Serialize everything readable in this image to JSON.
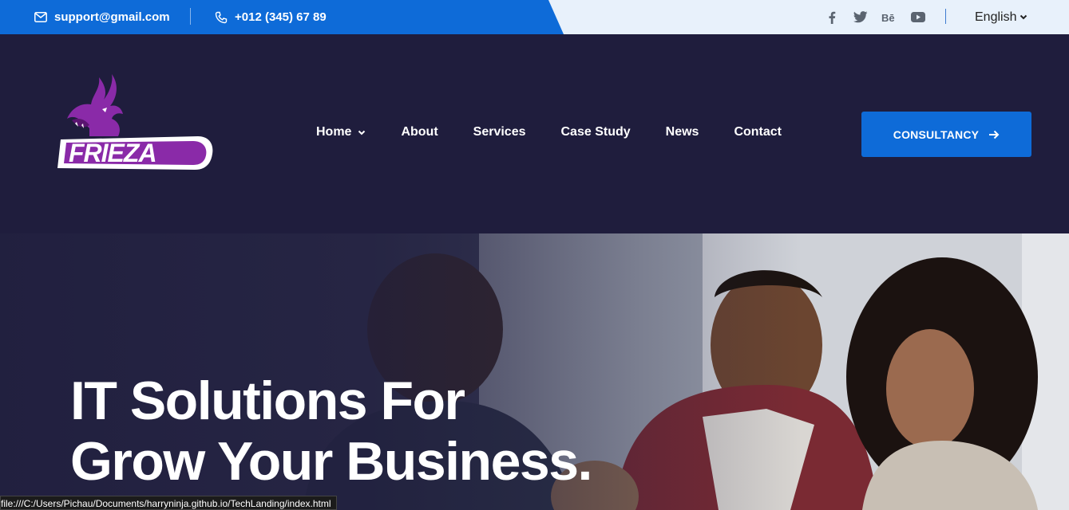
{
  "topbar": {
    "email": "support@gmail.com",
    "phone": "+012 (345) 67 89",
    "socials": [
      "facebook-icon",
      "twitter-icon",
      "behance-icon",
      "youtube-icon"
    ],
    "language": "English"
  },
  "header": {
    "logo_text": "FRIEZA",
    "nav": [
      {
        "label": "Home",
        "has_dropdown": true
      },
      {
        "label": "About"
      },
      {
        "label": "Services"
      },
      {
        "label": "Case Study"
      },
      {
        "label": "News"
      },
      {
        "label": "Contact"
      }
    ],
    "cta_label": "CONSULTANCY"
  },
  "hero": {
    "title_line1": "IT Solutions For",
    "title_line2": "Grow Your Business."
  },
  "statusbar": {
    "url": "file:///C:/Users/Pichau/Documents/harryninja.github.io/TechLanding/index.html"
  },
  "colors": {
    "accent": "#0e6bd8",
    "navy": "#1f1d3d",
    "topbar_light": "#e8f1fb",
    "logo_purple": "#8a2aa8"
  }
}
